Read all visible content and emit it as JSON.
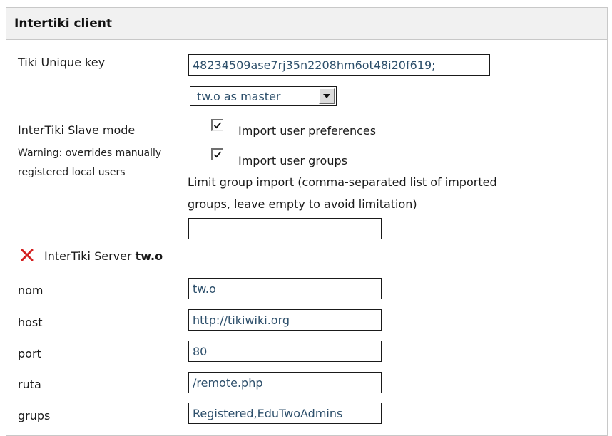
{
  "panel": {
    "title": "Intertiki client"
  },
  "unique_key": {
    "label": "Tiki Unique key",
    "value": "48234509ase7rj35n2208hm6ot48i20f619;"
  },
  "master_select": {
    "selected": "tw.o as master"
  },
  "slave_mode": {
    "label": "InterTiki Slave mode",
    "warning": "Warning: overrides manually registered local users",
    "import_prefs_label": "Import user preferences",
    "import_prefs_checked": true,
    "import_groups_label": "Import user groups",
    "import_groups_checked": true,
    "limit_label_line1": "Limit group import (comma-separated list of imported",
    "limit_label_line2": "groups, leave empty to avoid limitation)",
    "limit_value": ""
  },
  "server": {
    "prefix": "InterTiki Server ",
    "name": "tw.o",
    "icon": "delete-x-icon",
    "icon_color": "#d42020",
    "fields": {
      "nom": {
        "label": "nom",
        "value": "tw.o"
      },
      "host": {
        "label": "host",
        "value": "http://tikiwiki.org"
      },
      "port": {
        "label": "port",
        "value": "80"
      },
      "ruta": {
        "label": "ruta",
        "value": "/remote.php"
      },
      "grups": {
        "label": "grups",
        "value": "Registered,EduTwoAdmins"
      }
    }
  },
  "colors": {
    "header_bg": "#f1f1f1",
    "border": "#c8c8c8",
    "input_text": "#2d4f6b"
  }
}
